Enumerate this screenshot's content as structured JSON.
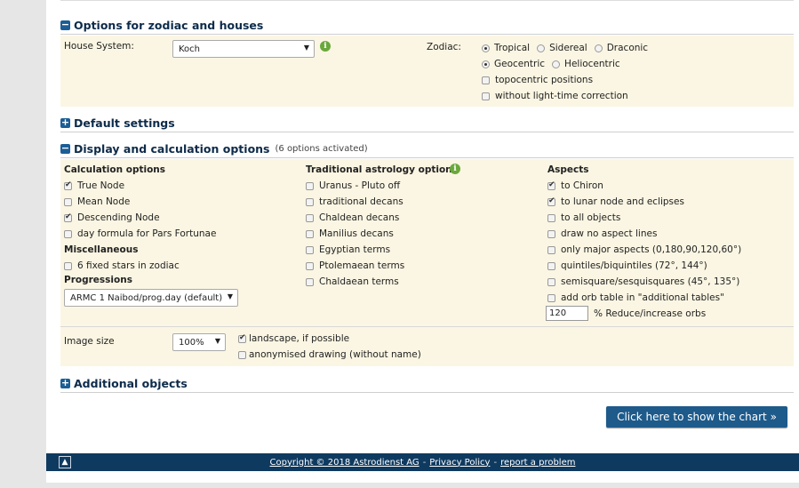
{
  "zodiac_section": {
    "title": "Options for zodiac and houses",
    "house_label": "House System:",
    "house_value": "Koch",
    "zodiac_label": "Zodiac:",
    "tropical": "Tropical",
    "sidereal": "Sidereal",
    "draconic": "Draconic",
    "geocentric": "Geocentric",
    "heliocentric": "Heliocentric",
    "topocentric": "topocentric positions",
    "light_time": "without light-time correction"
  },
  "default_section": {
    "title": "Default settings"
  },
  "display_section": {
    "title": "Display and calculation options",
    "note": "(6 options activated)",
    "calc_title": "Calculation options",
    "calc": [
      "True Node",
      "Mean Node",
      "Descending Node",
      "day formula for Pars Fortunae"
    ],
    "misc_title": "Miscellaneous",
    "misc": [
      "6 fixed stars in zodiac"
    ],
    "prog_title": "Progressions",
    "prog_value": "ARMC 1 Naibod/prog.day (default)",
    "trad_title": "Traditional astrology options",
    "trad": [
      "Uranus - Pluto off",
      "traditional decans",
      "Chaldean decans",
      "Manilius decans",
      "Egyptian terms",
      "Ptolemaean terms",
      "Chaldaean terms"
    ],
    "asp_title": "Aspects",
    "asp": [
      "to Chiron",
      "to lunar node and eclipses",
      "to all objects",
      "draw no aspect lines",
      "only major aspects (0,180,90,120,60°)",
      "quintiles/biquintiles (72°, 144°)",
      "semisquare/sesquisquares (45°, 135°)",
      "add orb table in \"additional tables\""
    ],
    "orb_value": "120",
    "orb_label": "% Reduce/increase orbs",
    "image_label": "Image size",
    "image_value": "100%",
    "landscape": "landscape, if possible",
    "anonymised": "anonymised drawing (without name)"
  },
  "additional_section": {
    "title": "Additional objects"
  },
  "show_button": "Click here to show the chart »",
  "footer": {
    "copyright": "Copyright © 2018 Astrodienst AG",
    "privacy": "Privacy Policy",
    "report": "report a problem",
    "sep": "-"
  },
  "icons": {
    "expand": "plus-box-icon",
    "collapse": "minus-box-icon",
    "info": "info-icon",
    "up": "arrow-up-icon"
  },
  "colors": {
    "accent": "#1e5a8a",
    "panel": "#fbf6e3",
    "footer": "#0f3a60",
    "info": "#6aa83c"
  }
}
